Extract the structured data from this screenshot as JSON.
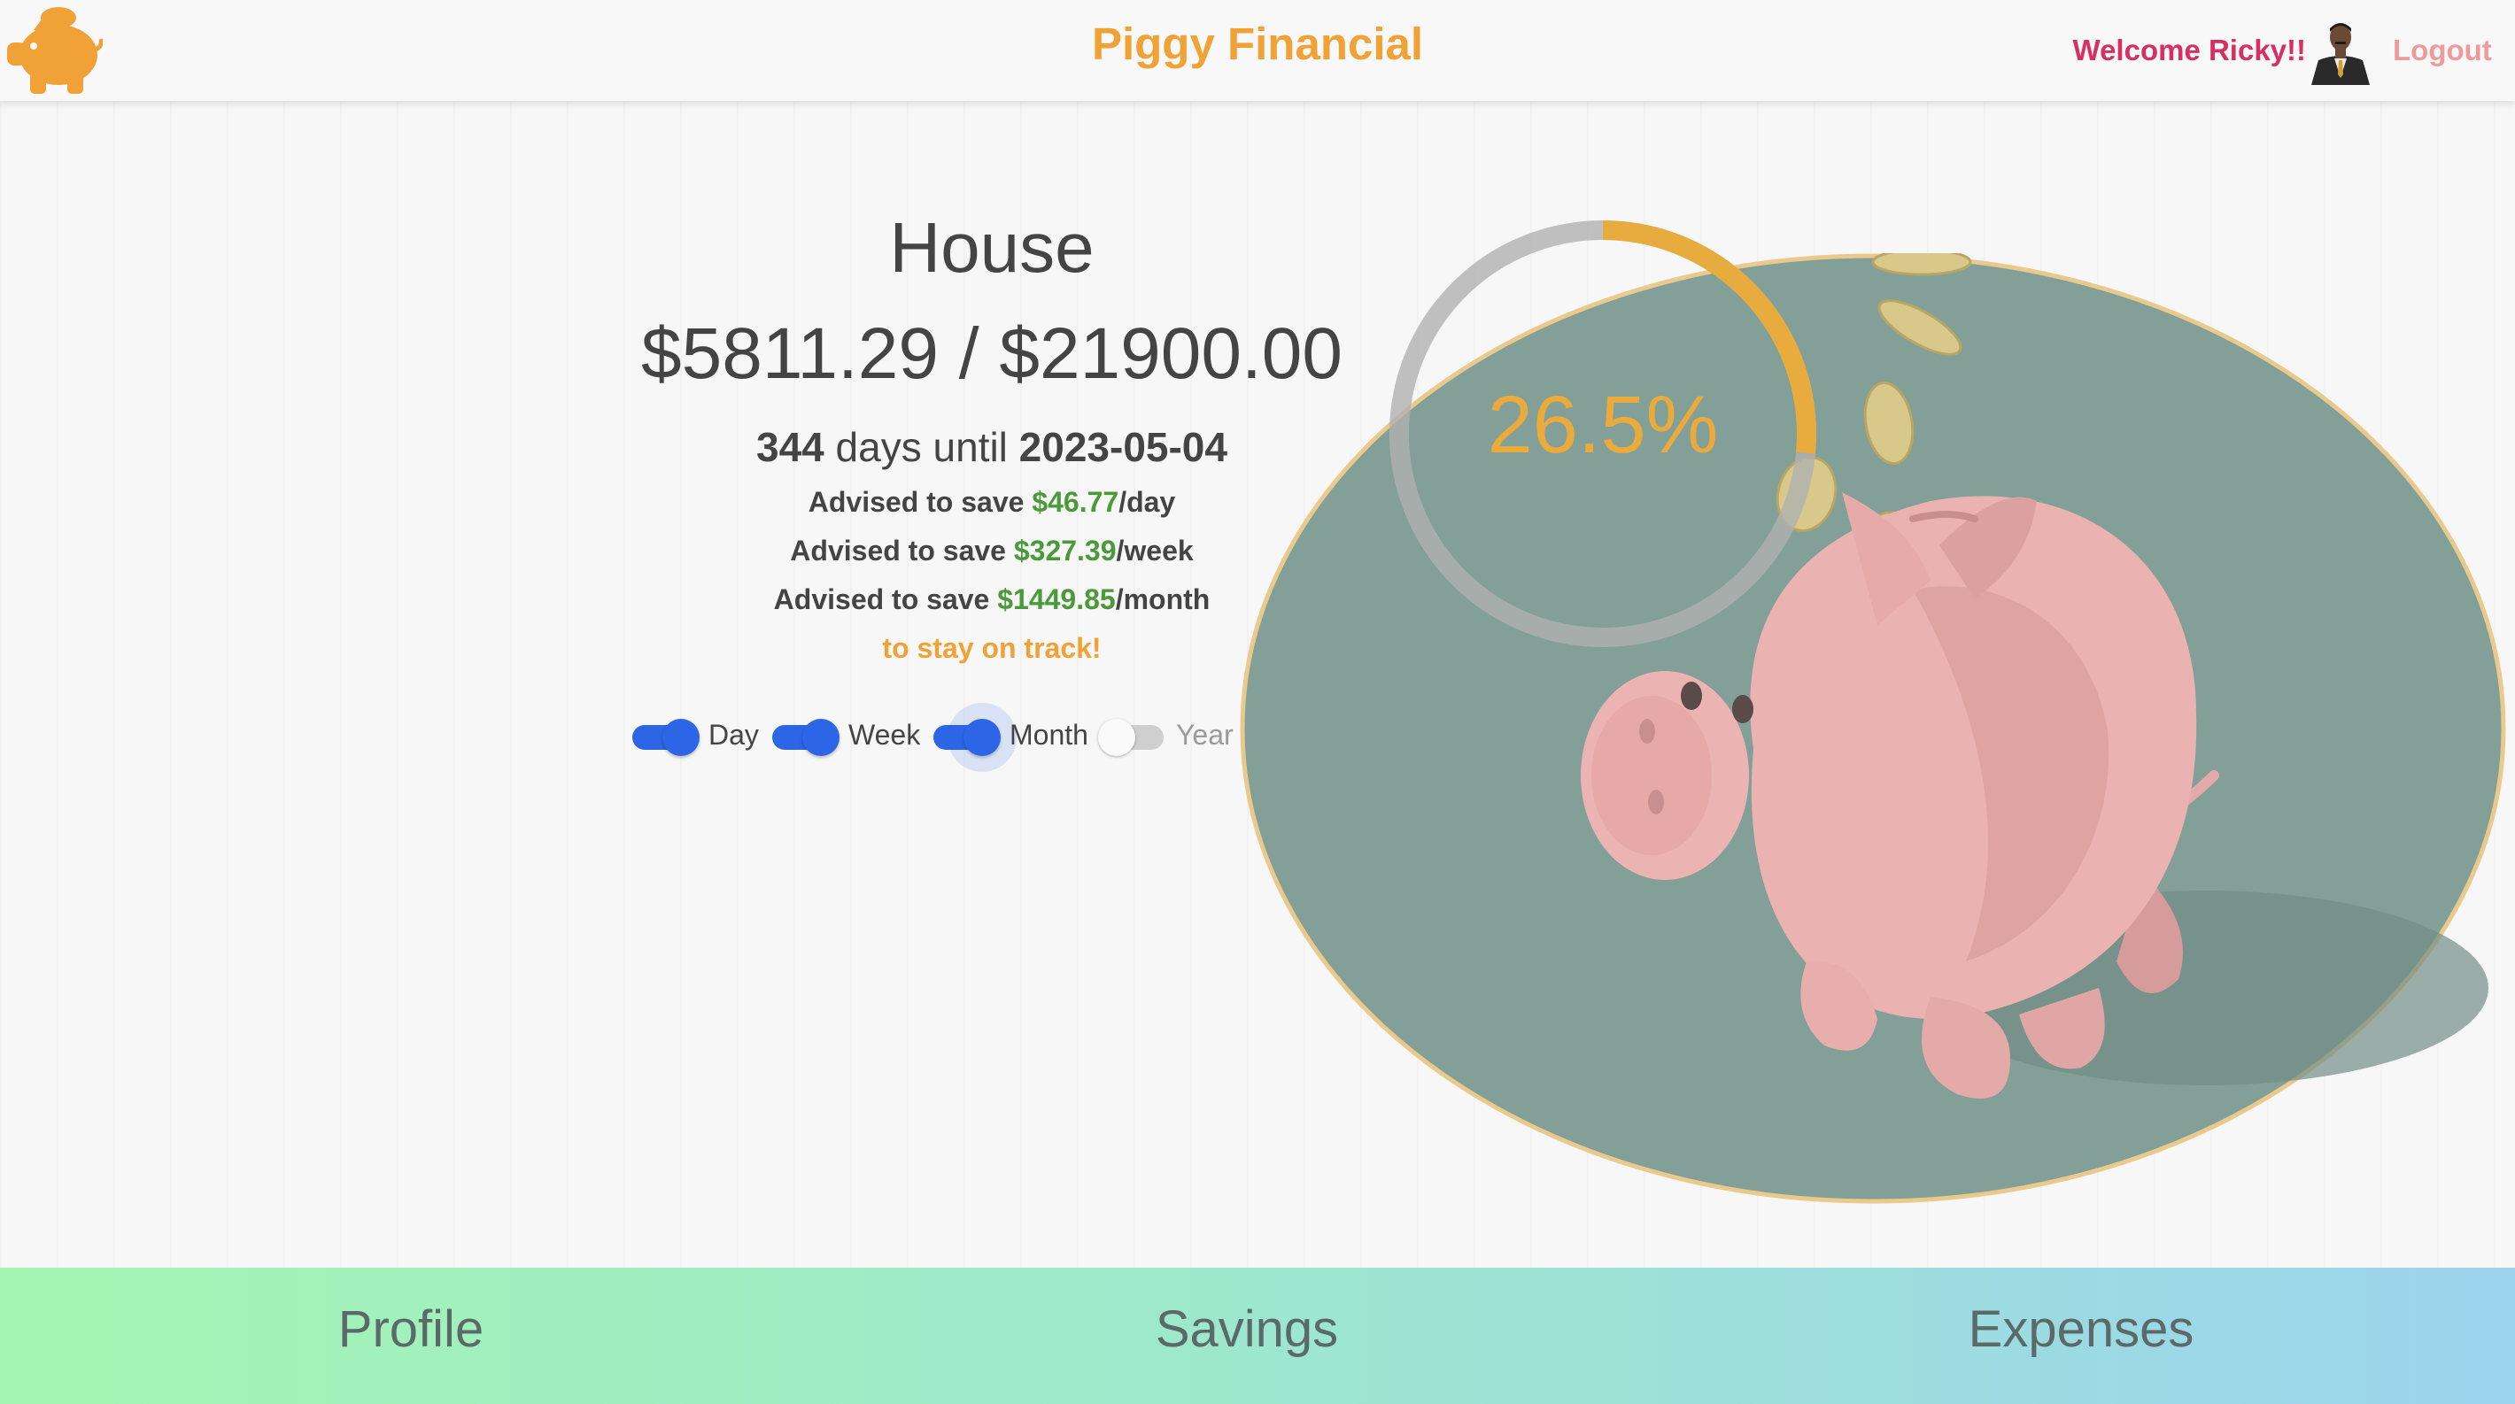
{
  "header": {
    "brand": "Piggy Financial",
    "welcome": "Welcome Ricky!!",
    "logout": "Logout",
    "accent_color": "#f0a236"
  },
  "goal": {
    "name": "House",
    "saved": "$5811.29",
    "separator": "/",
    "target": "$21900.00",
    "days": "344",
    "days_text": "days until",
    "date": "2023-05-04",
    "advice_prefix": "Advised to save",
    "advice": [
      {
        "amount": "$46.77",
        "unit": "/day"
      },
      {
        "amount": "$327.39",
        "unit": "/week"
      },
      {
        "amount": "$1449.85",
        "unit": "/month"
      }
    ],
    "on_track": "to stay on track!"
  },
  "toggles": [
    {
      "label": "Day",
      "on": true
    },
    {
      "label": "Week",
      "on": true
    },
    {
      "label": "Month",
      "on": true
    },
    {
      "label": "Year",
      "on": false
    }
  ],
  "progress": {
    "percent_label": "26.5%",
    "fraction": 0.265,
    "color": "#e8ac3e"
  },
  "nav": {
    "items": [
      "Profile",
      "Savings",
      "Expenses"
    ]
  }
}
